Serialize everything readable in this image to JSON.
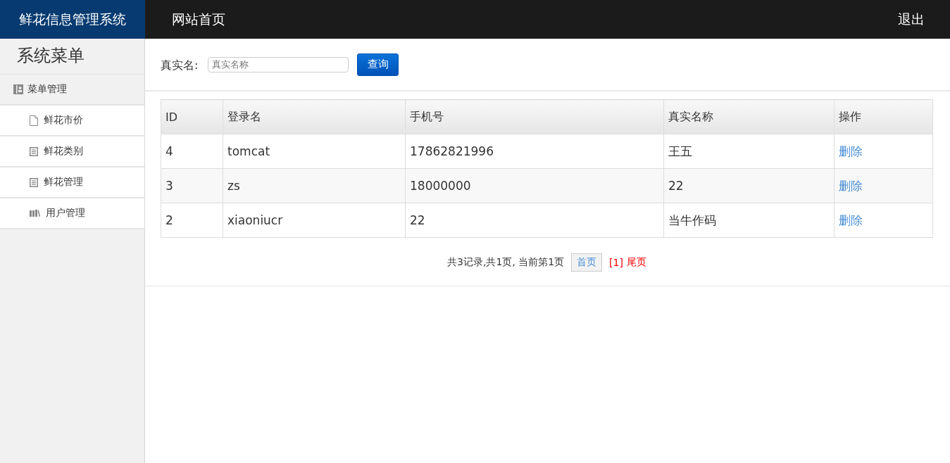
{
  "header": {
    "brand": "鲜花信息管理系统",
    "nav": "网站首页",
    "logout": "退出"
  },
  "sidebar": {
    "title": "系统菜单",
    "group": "菜单管理",
    "items": [
      {
        "label": "鲜花市价",
        "kind": "page"
      },
      {
        "label": "鲜花类别",
        "kind": "list"
      },
      {
        "label": "鲜花管理",
        "kind": "list"
      },
      {
        "label": "用户管理",
        "kind": "books"
      }
    ]
  },
  "search": {
    "label": "真实名:",
    "placeholder": "真实名称",
    "button": "查询"
  },
  "table": {
    "columns": [
      "ID",
      "登录名",
      "手机号",
      "真实名称",
      "操作"
    ],
    "rows": [
      {
        "id": "4",
        "login": "tomcat",
        "phone": "17862821996",
        "name": "王五",
        "action": "删除"
      },
      {
        "id": "3",
        "login": "zs",
        "phone": "18000000",
        "name": "22",
        "action": "删除"
      },
      {
        "id": "2",
        "login": "xiaoniucr",
        "phone": "22",
        "name": "当牛作码",
        "action": "删除"
      }
    ]
  },
  "pagination": {
    "summary": "共3记录,共1页, 当前第1页",
    "first": "首页",
    "current": "[1]",
    "last": "尾页"
  }
}
